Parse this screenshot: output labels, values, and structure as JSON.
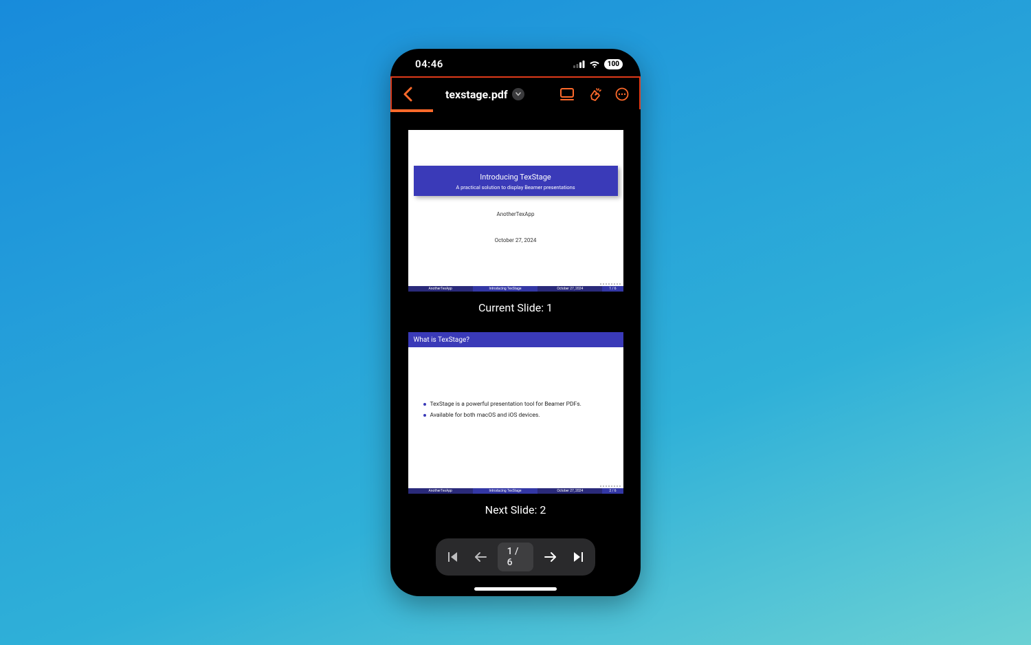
{
  "status": {
    "time": "04:46",
    "battery": "100"
  },
  "nav": {
    "document_title": "texstage.pdf"
  },
  "progress": {
    "fraction": 0.17
  },
  "current_slide": {
    "label": "Current Slide: 1",
    "title": "Introducing TexStage",
    "subtitle": "A practical solution to display Beamer presentations",
    "author": "AnotherTexApp",
    "date": "October 27, 2024",
    "footer": {
      "left": "AnotherTexApp",
      "center": "Introducing TexStage",
      "right": "October 27, 2024",
      "page": "1 / 6"
    }
  },
  "next_slide": {
    "label": "Next Slide: 2",
    "frametitle": "What is TexStage?",
    "bullets": [
      "TexStage is a powerful presentation tool for Beamer PDFs.",
      "Available for both macOS and iOS devices."
    ],
    "footer": {
      "left": "AnotherTexApp",
      "center": "Introducing TexStage",
      "right": "October 27, 2024",
      "page": "2 / 6"
    }
  },
  "toolbar": {
    "page_indicator": "1 / 6"
  },
  "colors": {
    "accent": "#ff6a2b",
    "beamer_blue": "#3a3ab8"
  }
}
